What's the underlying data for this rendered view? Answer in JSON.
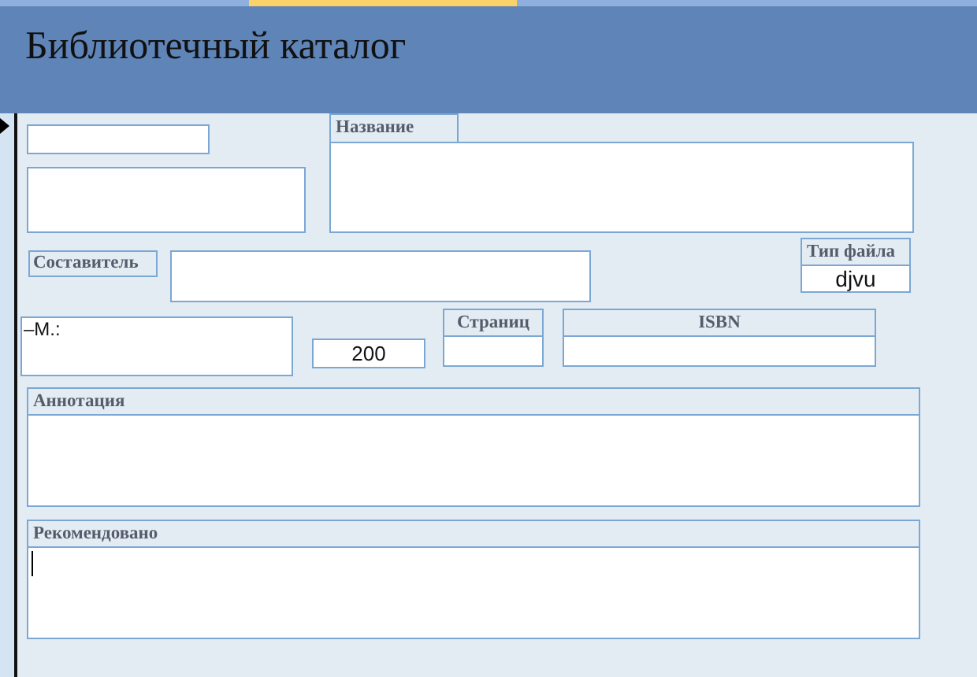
{
  "window": {
    "title": "Библиотечный каталог"
  },
  "record_selector": {
    "current": true
  },
  "form": {
    "name": {
      "label": "Название"
    },
    "compiler": {
      "label": "Составитель"
    },
    "file_type": {
      "label": "Тип файла",
      "value": "djvu"
    },
    "place_field": {
      "value": "–M.:"
    },
    "short_field": {
      "value": "200"
    },
    "pages": {
      "label": "Страниц"
    },
    "isbn": {
      "label": "ISBN"
    },
    "annotation": {
      "label": "Аннотация"
    },
    "recommended": {
      "label": "Рекомендовано",
      "focused": true
    }
  }
}
